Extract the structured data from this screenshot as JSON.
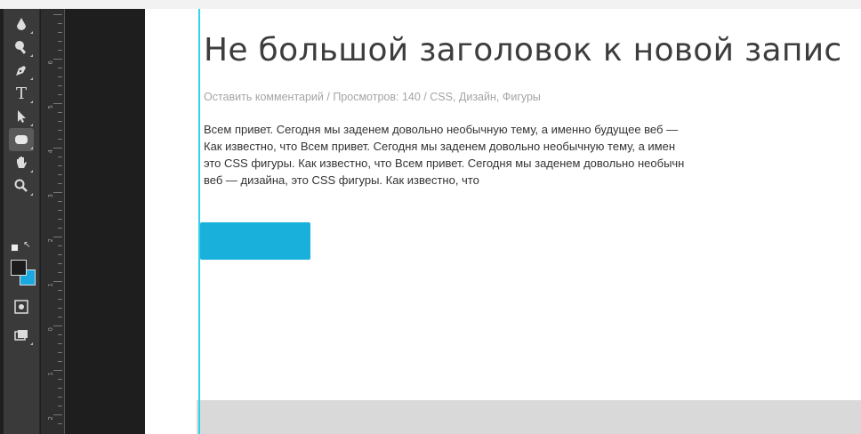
{
  "toolbar": {
    "tools": [
      {
        "name": "paint-bucket-tool",
        "icon": "paint-bucket-icon"
      },
      {
        "name": "dodge-tool",
        "icon": "dodge-icon"
      },
      {
        "name": "pen-tool",
        "icon": "pen-icon"
      },
      {
        "name": "type-tool",
        "icon": "type-icon",
        "label": "T"
      },
      {
        "name": "path-selection-tool",
        "icon": "arrow-icon"
      },
      {
        "name": "rounded-rectangle-tool",
        "icon": "rounded-rectangle-icon",
        "active": true
      },
      {
        "name": "hand-tool",
        "icon": "hand-icon"
      },
      {
        "name": "zoom-tool",
        "icon": "zoom-icon"
      },
      {
        "name": "quick-mask-button",
        "icon": "quick-mask-icon"
      },
      {
        "name": "screen-mode-button",
        "icon": "screen-mode-icon"
      }
    ],
    "foreground_color": "#1c1c1c",
    "background_color": "#1aa8e0"
  },
  "ruler": {
    "numbers": [
      "6",
      "5",
      "4",
      "3",
      "2",
      "1",
      "0",
      "1",
      "2"
    ]
  },
  "canvas": {
    "title": "Не большой заголовок к новой запис",
    "meta": "Оставить комментарий / Просмотров: 140 / CSS, Дизайн, Фигуры",
    "body_lines": [
      "Всем привет. Сегодня мы заденем довольно необычную тему, а именно будущее веб —",
      "Как известно, что Всем привет. Сегодня мы заденем довольно необычную тему, а имен",
      "это CSS фигуры. Как известно, что Всем привет. Сегодня мы заденем довольно необычн",
      "веб — дизайна, это CSS фигуры. Как известно, что"
    ],
    "button_color": "#1ab0dc",
    "guide_color": "#34d4e8",
    "footer_color": "#d9d9d9"
  }
}
